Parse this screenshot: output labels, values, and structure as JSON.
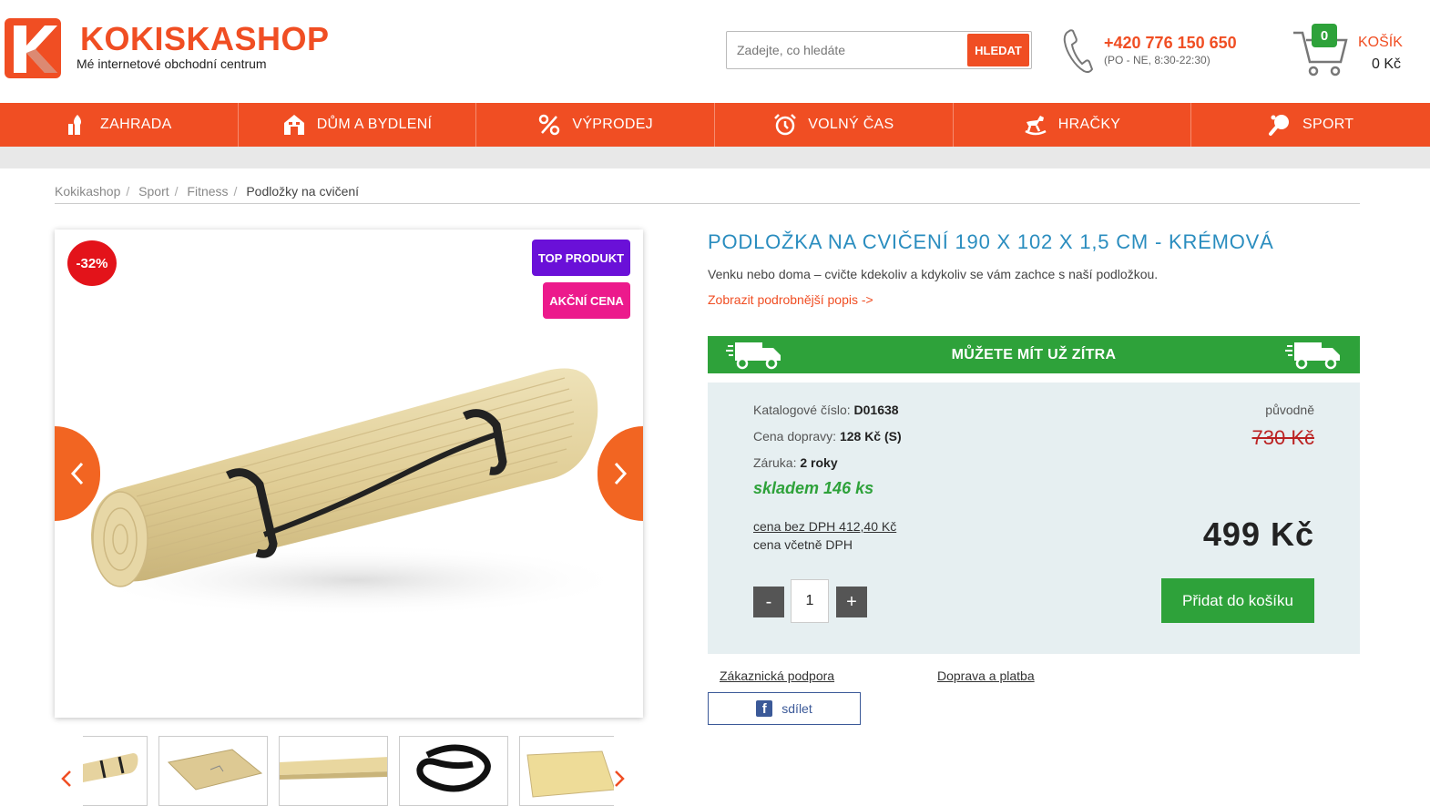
{
  "header": {
    "brand_name": "KOKISKASHOP",
    "brand_tagline": "Mé internetové obchodní centrum",
    "search_placeholder": "Zadejte, co hledáte",
    "search_button": "HLEDAT",
    "phone_number": "+420 776 150 650",
    "phone_hours": "(PO - NE, 8:30-22:30)",
    "cart_count": "0",
    "cart_label": "KOŠÍK",
    "cart_amount": "0 Kč"
  },
  "nav": {
    "items": [
      {
        "label": "ZAHRADA",
        "icon": "garden-icon"
      },
      {
        "label": "DŮM A BYDLENÍ",
        "icon": "house-icon"
      },
      {
        "label": "VÝPRODEJ",
        "icon": "percent-icon"
      },
      {
        "label": "VOLNÝ ČAS",
        "icon": "alarm-clock-icon"
      },
      {
        "label": "HRAČKY",
        "icon": "rocking-horse-icon"
      },
      {
        "label": "SPORT",
        "icon": "ping-pong-icon"
      }
    ]
  },
  "breadcrumb": {
    "items": [
      "Kokikashop",
      "Sport",
      "Fitness",
      "Podložky na cvičení"
    ],
    "separator": "/"
  },
  "gallery": {
    "discount_badge": "-32%",
    "top_badge": "TOP PRODUKT",
    "sale_badge": "AKČNÍ CENA"
  },
  "product": {
    "title": "PODLOŽKA NA CVIČENÍ 190 X 102 X 1,5 CM - KRÉMOVÁ",
    "short_description": "Venku nebo doma – cvičte kdekoliv a kdykoliv se vám zachce s naší podložkou.",
    "more_link": "Zobrazit podrobnější popis ->",
    "delivery_banner": "MŮŽETE MÍT UŽ ZÍTRA",
    "catalog_label": "Katalogové číslo:",
    "catalog_value": "D01638",
    "shipping_label": "Cena dopravy:",
    "shipping_value": "128 Kč (S)",
    "warranty_label": "Záruka:",
    "warranty_value": "2 roky",
    "stock": "skladem 146 ks",
    "price_no_vat": "cena bez DPH 412,40 Kč",
    "price_with_vat_label": "cena včetně DPH",
    "original_label": "původně",
    "original_price": "730 Kč",
    "price": "499 Kč",
    "qty_minus": "-",
    "qty_value": "1",
    "qty_plus": "+",
    "add_to_cart": "Přidat do košíku"
  },
  "links": {
    "support": "Zákaznická podpora",
    "shipping": "Doprava a platba",
    "share": "sdílet"
  },
  "colors": {
    "brand": "#f04e23",
    "green": "#2ea23a",
    "title_blue": "#2a8dbf",
    "badge_purple": "#6a10d8",
    "badge_pink": "#ec1a8c",
    "badge_red": "#e3131a"
  }
}
